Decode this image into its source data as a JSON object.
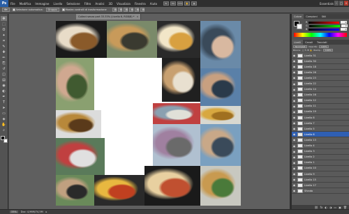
{
  "app": {
    "logo": "Ps",
    "menu": [
      "File",
      "Modifica",
      "Immagine",
      "Livello",
      "Selezione",
      "Filtro",
      "Analisi",
      "3D",
      "Visualizza",
      "Finestra",
      "Aiuto"
    ],
    "zoom_display": "33%",
    "workspace": "Essentials",
    "window_controls": [
      "–",
      "□",
      "×"
    ]
  },
  "options": {
    "auto_select_label": "Selezione automatica:",
    "auto_select_value": "Gruppo",
    "transform_label": "Mostra controlli di trasformazione"
  },
  "toolbar": {
    "tools": [
      "move-icon",
      "marquee-icon",
      "lasso-icon",
      "magic-wand-icon",
      "crop-icon",
      "eyedropper-icon",
      "healing-icon",
      "brush-icon",
      "clone-icon",
      "history-brush-icon",
      "eraser-icon",
      "gradient-icon",
      "blur-icon",
      "dodge-icon",
      "pen-icon",
      "type-icon",
      "path-select-icon",
      "shape-icon",
      "3d-icon",
      "hand-icon",
      "zoom-icon"
    ],
    "tool_glyphs": [
      "✥",
      "⬚",
      "ʘ",
      "✦",
      "⌗",
      "✎",
      "✚",
      "✏",
      "⎘",
      "↺",
      "◫",
      "▤",
      "◉",
      "◐",
      "✒",
      "T",
      "➤",
      "▭",
      "◈",
      "✋",
      "⌕"
    ]
  },
  "document": {
    "tab_title": "Collect senza part 33.33% (Livello 6, RGB/8) *",
    "tab_close": "×"
  },
  "status": {
    "zoom": "33%",
    "doc_info": "Doc: 4,96M/74,5M"
  },
  "panels": {
    "color_tabs": [
      "Colore",
      "Campioni",
      "Stili"
    ],
    "sliders": [
      {
        "label": "R",
        "value": "0",
        "color_from": "#000000",
        "color_to": "#ff0000"
      },
      {
        "label": "G",
        "value": "0",
        "color_from": "#000000",
        "color_to": "#00ff00"
      },
      {
        "label": "B",
        "value": "0",
        "color_from": "#000000",
        "color_to": "#0000ff"
      }
    ],
    "layers_tabs": [
      "Livelli",
      "Canali",
      "Tracciati"
    ],
    "blend_mode": "Normale",
    "opacity_label": "Opacità:",
    "opacity_value": "100%",
    "lock_label": "Blocca:",
    "fill_label": "Riemp.:",
    "fill_value": "100%",
    "layers": [
      {
        "name": "Livello 31",
        "selected": false
      },
      {
        "name": "Livello 30",
        "selected": false
      },
      {
        "name": "Livello 18",
        "selected": false
      },
      {
        "name": "Livello 26",
        "selected": false
      },
      {
        "name": "Livello 23",
        "selected": false
      },
      {
        "name": "Livello 22",
        "selected": false
      },
      {
        "name": "Livello 14",
        "selected": false
      },
      {
        "name": "Livello 16",
        "selected": false
      },
      {
        "name": "Livello 12",
        "selected": false
      },
      {
        "name": "Livello 11",
        "selected": false
      },
      {
        "name": "Livello 19",
        "selected": false
      },
      {
        "name": "Livello 8",
        "selected": false
      },
      {
        "name": "Livello 7",
        "selected": false
      },
      {
        "name": "Livello 5",
        "selected": false
      },
      {
        "name": "Livello 6",
        "selected": true
      },
      {
        "name": "Livello 13",
        "selected": false
      },
      {
        "name": "Livello 4",
        "selected": false
      },
      {
        "name": "Livello 3",
        "selected": false
      },
      {
        "name": "Livello 2",
        "selected": false
      },
      {
        "name": "Livello 1",
        "selected": false
      },
      {
        "name": "Livello 10",
        "selected": false
      },
      {
        "name": "Livello 9",
        "selected": false
      },
      {
        "name": "Livello 15",
        "selected": false
      },
      {
        "name": "Livello 17",
        "selected": false
      },
      {
        "name": "Sfondo",
        "selected": false
      }
    ],
    "footer_icons": [
      "link-icon",
      "fx-icon",
      "mask-icon",
      "adjustment-icon",
      "folder-icon",
      "new-layer-icon",
      "trash-icon"
    ],
    "footer_glyphs": [
      "⛓",
      "fx",
      "◐",
      "◑",
      "▭",
      "▣",
      "🗑"
    ]
  },
  "photos": [
    {
      "label": "chinese-takeout",
      "colors": [
        "#1a1a1a",
        "#e8dcc8",
        "#8a5a2a"
      ]
    },
    {
      "label": "hand-holding-burger",
      "colors": [
        "#7a8a6a",
        "#c89a5a",
        "#3a3a30"
      ]
    },
    {
      "label": "fries-box",
      "colors": [
        "#2a2a2a",
        "#f2e6c8",
        "#d8a040"
      ]
    },
    {
      "label": "man-eating-outdoors",
      "colors": [
        "#6a8aa8",
        "#3a4a5a",
        "#d8b8a0"
      ]
    },
    {
      "label": "woman-eating-pretzel",
      "colors": [
        "#8aa070",
        "#d0a890",
        "#405a30"
      ]
    },
    {
      "label": "hotdog-closeup",
      "colors": [
        "#202020",
        "#c8a070",
        "#e8e0d0"
      ]
    },
    {
      "label": "woman-smiling",
      "colors": [
        "#5a80a8",
        "#c8a080",
        "#2a3a4a"
      ]
    },
    {
      "label": "burger-plate",
      "colors": [
        "#dcdcdc",
        "#b8883a",
        "#5a3a1a"
      ]
    },
    {
      "label": "omelette-slice",
      "colors": [
        "#d8d8d0",
        "#d8a840",
        "#a07020"
      ]
    },
    {
      "label": "street-kiosk",
      "colors": [
        "#5a7a5a",
        "#c04040",
        "#e0e0e0"
      ]
    },
    {
      "label": "food-stand-counter",
      "colors": [
        "#b0c0d0",
        "#a080a0",
        "#6a6a6a"
      ]
    },
    {
      "label": "man-eating-sitting",
      "colors": [
        "#7aa0c0",
        "#c8a888",
        "#3a4a5a"
      ]
    },
    {
      "label": "pizza-slices-plate",
      "colors": [
        "#1a1a1a",
        "#e8d0a0",
        "#c05030"
      ]
    },
    {
      "label": "green-burger",
      "colors": [
        "#c8c8c0",
        "#c89a50",
        "#4a7a3a"
      ]
    },
    {
      "label": "man-eating-sandwich",
      "colors": [
        "#6a8a5a",
        "#c0a080",
        "#2a2a2a"
      ]
    },
    {
      "label": "bakery-display",
      "colors": [
        "#2a2a2a",
        "#e8b840",
        "#c04020"
      ]
    },
    {
      "label": "kiosk-street-view",
      "colors": [
        "#c04040",
        "#8aa0b0",
        "#e0e0d8"
      ]
    }
  ]
}
